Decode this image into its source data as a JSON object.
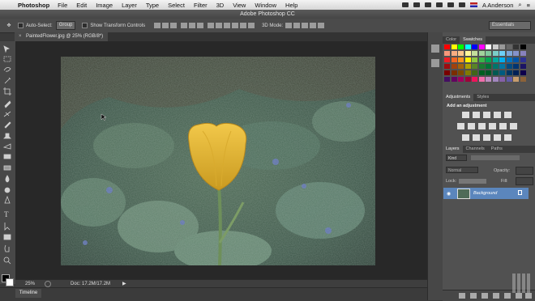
{
  "menubar": {
    "app_name": "Photoshop",
    "items": [
      "File",
      "Edit",
      "Image",
      "Layer",
      "Type",
      "Select",
      "Filter",
      "3D",
      "View",
      "Window",
      "Help"
    ],
    "user": "A Anderson"
  },
  "titlebar": {
    "title": "Adobe Photoshop CC"
  },
  "options": {
    "auto_select": "Auto-Select:",
    "group_value": "Group",
    "show_transform": "Show Transform Controls",
    "mode_3d": "3D Mode:",
    "workspace": "Essentials"
  },
  "document": {
    "tab_label": "PaintedFlower.jpg @ 25% (RGB/8*)",
    "close": "×",
    "zoom": "25%",
    "doc_info": "Doc: 17.2M/17.2M"
  },
  "timeline": {
    "label": "Timeline"
  },
  "panels": {
    "color_tab": "Color",
    "swatches_tab": "Swatches",
    "adjustments_tab": "Adjustments",
    "styles_tab": "Styles",
    "add_adjustment": "Add an adjustment",
    "layers_tab": "Layers",
    "channels_tab": "Channels",
    "paths_tab": "Paths",
    "kind_label": "Kind",
    "blend_mode": "Normal",
    "opacity_label": "Opacity:",
    "lock_label": "Lock:",
    "fill_label": "Fill:",
    "layer_name": "Background"
  },
  "swatch_colors": [
    "#ff0000",
    "#ffff00",
    "#00ff00",
    "#00ffff",
    "#0000ff",
    "#ff00ff",
    "#ffffff",
    "#cccccc",
    "#999999",
    "#666666",
    "#333333",
    "#000000",
    "#f7977a",
    "#f9ad81",
    "#fdc68a",
    "#fff79a",
    "#c4df9b",
    "#a2d39c",
    "#82ca9d",
    "#7bcdc8",
    "#6ecff6",
    "#7ea7d8",
    "#8493ca",
    "#8882be",
    "#ed1c24",
    "#f26522",
    "#f7941d",
    "#fff200",
    "#8dc73f",
    "#39b54a",
    "#00a651",
    "#00a99d",
    "#00aeef",
    "#0072bc",
    "#0054a6",
    "#2e3192",
    "#9e0b0f",
    "#a0410d",
    "#a3620a",
    "#aba000",
    "#598527",
    "#197b30",
    "#007236",
    "#00746b",
    "#0076a3",
    "#004a80",
    "#003471",
    "#1b1464",
    "#790000",
    "#7b2e00",
    "#7d4900",
    "#827b00",
    "#406618",
    "#005e20",
    "#005826",
    "#005952",
    "#005b7f",
    "#003663",
    "#002157",
    "#0d004c",
    "#440e62",
    "#630460",
    "#9e005d",
    "#9e0039",
    "#ee145b",
    "#f06eaa",
    "#bd8cbf",
    "#a186be",
    "#8560a8",
    "#605ca8",
    "#c69c6d",
    "#8c6239"
  ]
}
